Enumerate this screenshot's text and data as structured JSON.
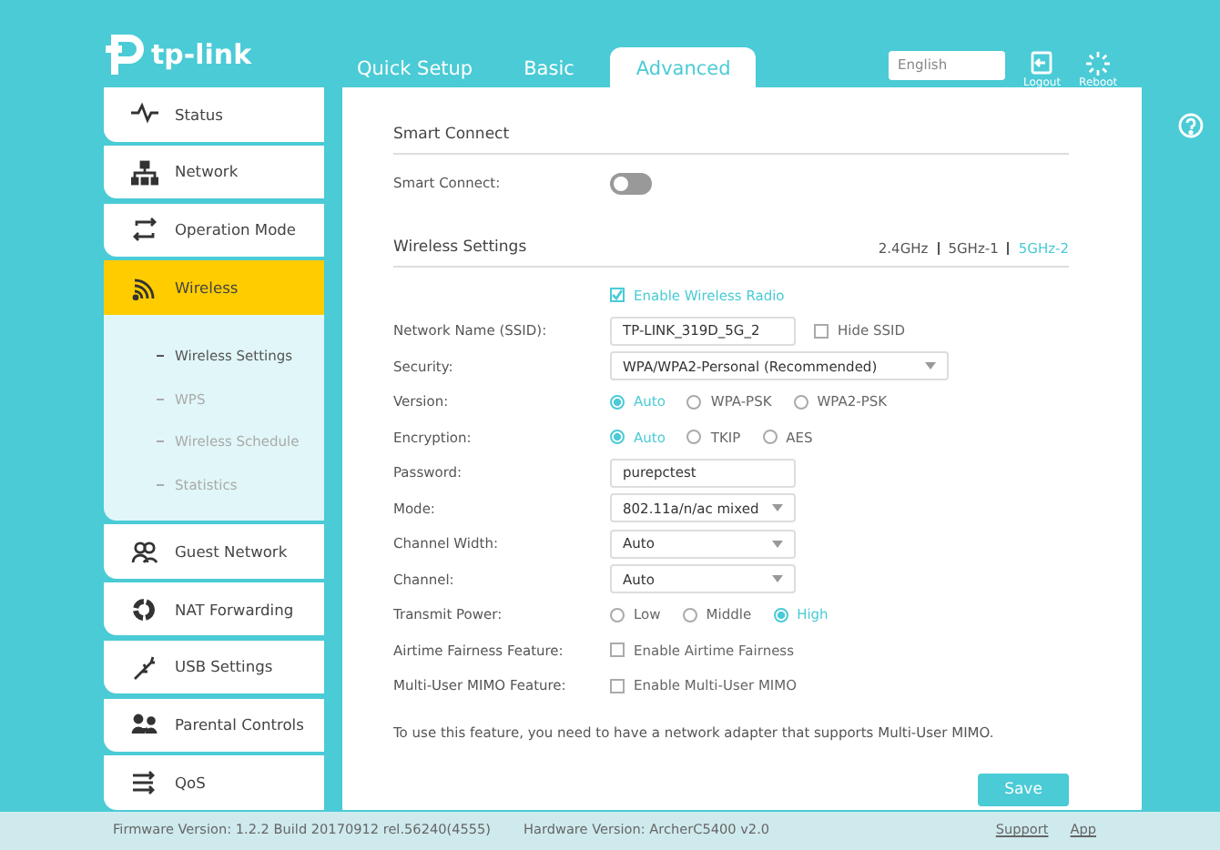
{
  "header": {
    "logo": "tp-link",
    "tabs": [
      {
        "label": "Quick Setup",
        "selected": false
      },
      {
        "label": "Basic",
        "selected": false
      },
      {
        "label": "Advanced",
        "selected": true
      }
    ],
    "language": "English",
    "actions": [
      {
        "kind": "logout",
        "label": "Logout"
      },
      {
        "kind": "reboot",
        "label": "Reboot"
      }
    ]
  },
  "sidebar": {
    "items": [
      {
        "kind": "status",
        "label": "Status",
        "selected": false
      },
      {
        "kind": "network",
        "label": "Network",
        "selected": false
      },
      {
        "kind": "mode",
        "label": "Operation Mode",
        "selected": false
      },
      {
        "kind": "wireless",
        "label": "Wireless",
        "selected": true,
        "expanded": true,
        "children": [
          {
            "label": "Wireless Settings",
            "selected": true
          },
          {
            "label": "WPS",
            "selected": false
          },
          {
            "label": "Wireless Schedule",
            "selected": false
          },
          {
            "label": "Statistics",
            "selected": false
          }
        ]
      },
      {
        "kind": "guest",
        "label": "Guest Network",
        "selected": false
      },
      {
        "kind": "nat",
        "label": "NAT Forwarding",
        "selected": false
      },
      {
        "kind": "usb",
        "label": "USB Settings",
        "selected": false
      },
      {
        "kind": "parental",
        "label": "Parental Controls",
        "selected": false
      },
      {
        "kind": "qos",
        "label": "QoS",
        "selected": false
      }
    ]
  },
  "smart_connect": {
    "title": "Smart Connect",
    "label": "Smart Connect:",
    "on": false
  },
  "wireless_settings": {
    "title": "Wireless Settings",
    "bands": [
      {
        "label": "2.4GHz",
        "selected": false
      },
      {
        "label": "5GHz-1",
        "selected": false
      },
      {
        "label": "5GHz-2",
        "selected": true
      }
    ],
    "enable_radio": {
      "label": "Enable Wireless Radio",
      "checked": true
    },
    "fields": [
      {
        "kind": "text",
        "label": "Network Name (SSID):",
        "value": "TP-LINK_319D_5G_2",
        "option": {
          "label": "Hide SSID",
          "checked": false
        }
      },
      {
        "kind": "select",
        "label": "Security:",
        "value": "WPA/WPA2-Personal (Recommended)",
        "wide": true
      },
      {
        "kind": "radio",
        "label": "Version:",
        "options": [
          {
            "label": "Auto",
            "selected": true
          },
          {
            "label": "WPA-PSK",
            "selected": false
          },
          {
            "label": "WPA2-PSK",
            "selected": false
          }
        ]
      },
      {
        "kind": "radio",
        "label": "Encryption:",
        "options": [
          {
            "label": "Auto",
            "selected": true
          },
          {
            "label": "TKIP",
            "selected": false
          },
          {
            "label": "AES",
            "selected": false
          }
        ]
      },
      {
        "kind": "text",
        "label": "Password:",
        "value": "purepctest"
      },
      {
        "kind": "select",
        "label": "Mode:",
        "value": "802.11a/n/ac mixed"
      },
      {
        "kind": "select",
        "label": "Channel Width:",
        "value": "Auto"
      },
      {
        "kind": "select",
        "label": "Channel:",
        "value": "Auto"
      },
      {
        "kind": "radio",
        "label": "Transmit Power:",
        "options": [
          {
            "label": "Low",
            "selected": false
          },
          {
            "label": "Middle",
            "selected": false
          },
          {
            "label": "High",
            "selected": true
          }
        ]
      },
      {
        "kind": "checkbox",
        "label": "Airtime Fairness Feature:",
        "option": {
          "label": "Enable Airtime Fairness",
          "checked": false
        }
      },
      {
        "kind": "checkbox",
        "label": "Multi-User MIMO Feature:",
        "option": {
          "label": "Enable Multi-User MIMO",
          "checked": false
        }
      }
    ],
    "note": "To use this feature, you need to have a network adapter that supports Multi-User MIMO.",
    "save_button": "Save"
  },
  "footer": {
    "firmware": "Firmware Version: 1.2.2 Build 20170912 rel.56240(4555)",
    "hardware": "Hardware Version: ArcherC5400 v2.0",
    "links": [
      "Support",
      "App"
    ]
  }
}
